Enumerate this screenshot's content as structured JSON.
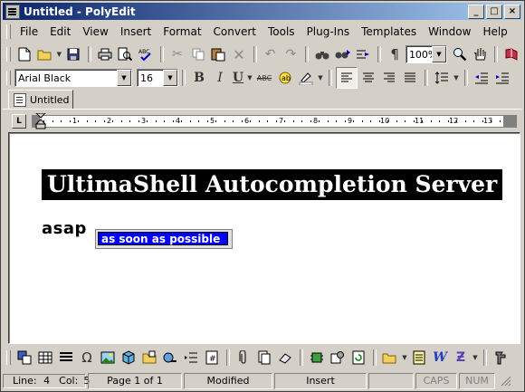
{
  "window": {
    "title": "Untitled - PolyEdit",
    "buttons": {
      "minimize": "_",
      "maximize": "□",
      "close": "×"
    }
  },
  "menu": {
    "items": [
      "File",
      "Edit",
      "View",
      "Insert",
      "Format",
      "Convert",
      "Tools",
      "Plug-Ins",
      "Templates",
      "Window",
      "Help"
    ]
  },
  "toolbar": {
    "zoom": "100%"
  },
  "format_bar": {
    "font": "Arial Black",
    "size": "16",
    "bold": "B",
    "italic": "I",
    "underline": "U",
    "strike": "ABC"
  },
  "tabs": [
    {
      "label": "Untitled"
    }
  ],
  "ruler": {
    "tab_marker": "L",
    "numbers": [
      "1",
      "2",
      "3",
      "4",
      "5",
      "6",
      "7",
      "8",
      "9",
      "10",
      "11",
      "12",
      "13"
    ]
  },
  "document": {
    "heading": "UltimaShell Autocompletion Server",
    "typed_word": "asap",
    "suggestion": "as soon as possible"
  },
  "status": {
    "line_label": "Line:",
    "line": "4",
    "col_label": "Col:",
    "col": "5",
    "page": "Page 1 of 1",
    "modified": "Modified",
    "insert": "Insert",
    "caps": "CAPS",
    "num": "NUM"
  },
  "colors": {
    "title_start": "#0a246a",
    "title_end": "#a6caf0",
    "selection": "#0000ff",
    "chrome": "#d4d0c8"
  }
}
